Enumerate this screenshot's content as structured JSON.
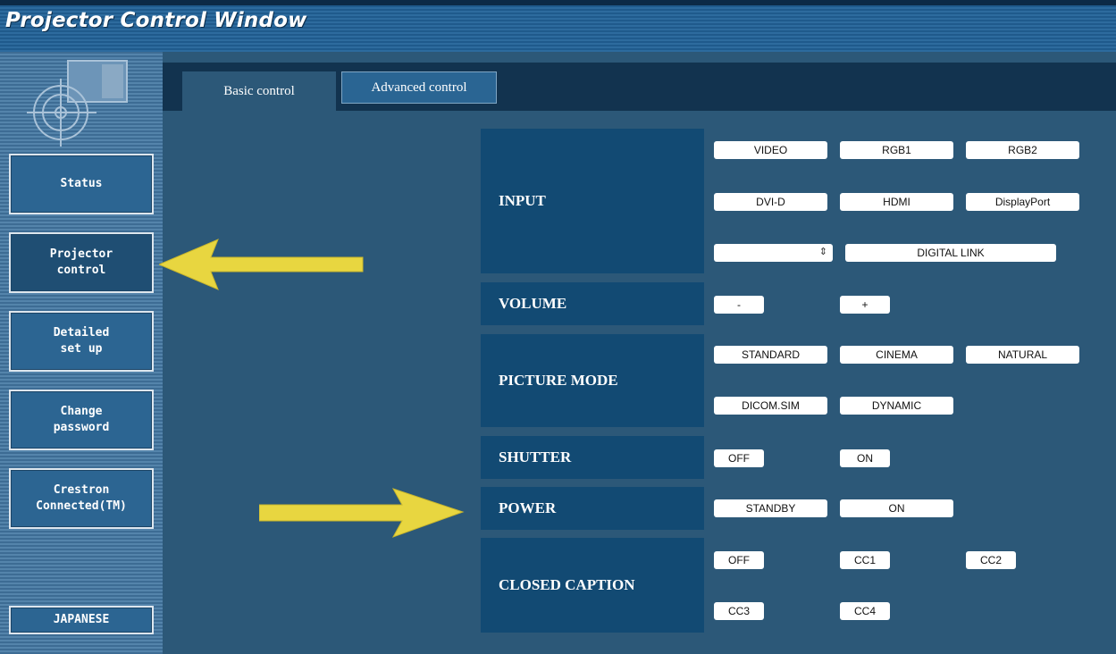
{
  "window": {
    "title": "Projector Control Window"
  },
  "sidebar": {
    "items": [
      {
        "label": "Status"
      },
      {
        "label": "Projector\ncontrol"
      },
      {
        "label": "Detailed\nset up"
      },
      {
        "label": "Change\npassword"
      },
      {
        "label": "Crestron\nConnected(TM)"
      }
    ],
    "language_button": "JAPANESE"
  },
  "tabs": [
    {
      "label": "Basic control",
      "active": true
    },
    {
      "label": "Advanced control",
      "active": false
    }
  ],
  "controls": {
    "input": {
      "label": "INPUT",
      "buttons": [
        "VIDEO",
        "RGB1",
        "RGB2",
        "DVI-D",
        "HDMI",
        "DisplayPort"
      ],
      "select_value": "",
      "digital_link": "DIGITAL LINK"
    },
    "volume": {
      "label": "VOLUME",
      "buttons": [
        "-",
        "+"
      ]
    },
    "picture_mode": {
      "label": "PICTURE MODE",
      "buttons": [
        "STANDARD",
        "CINEMA",
        "NATURAL",
        "DICOM.SIM",
        "DYNAMIC"
      ]
    },
    "shutter": {
      "label": "SHUTTER",
      "buttons": [
        "OFF",
        "ON"
      ]
    },
    "power": {
      "label": "POWER",
      "buttons": [
        "STANDBY",
        "ON"
      ]
    },
    "closed_caption": {
      "label": "CLOSED CAPTION",
      "buttons": [
        "OFF",
        "CC1",
        "CC2",
        "CC3",
        "CC4"
      ]
    }
  },
  "colors": {
    "annotation_arrow": "#e8d640",
    "title_bar": "#1f5a8c",
    "panel": "#2c5878",
    "label_box": "#124a73"
  },
  "icons": [
    "projector-logo-icon",
    "select-chevron-icon",
    "annotation-arrow-left-icon",
    "annotation-arrow-right-icon"
  ]
}
